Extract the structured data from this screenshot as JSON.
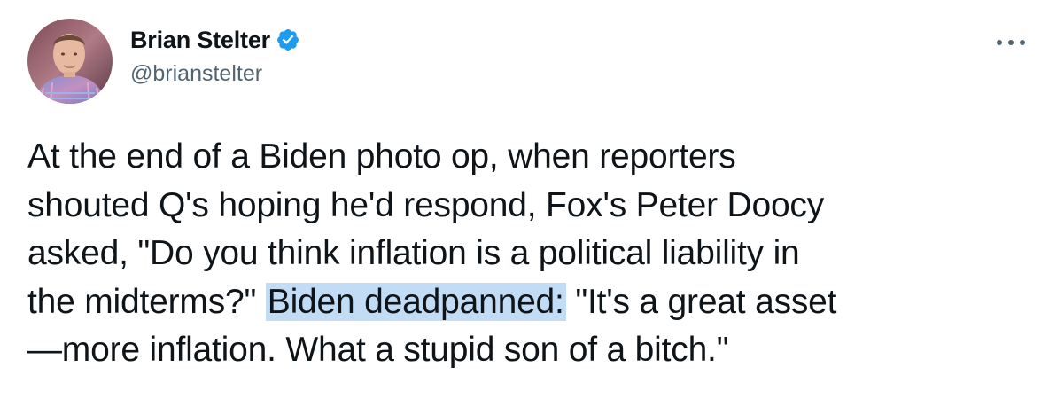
{
  "author": {
    "display_name": "Brian Stelter",
    "handle": "@brianstelter",
    "verified": true,
    "verified_icon": "verified-badge-icon",
    "verified_color": "#1d9bf0"
  },
  "menu": {
    "icon": "more-horizontal-icon"
  },
  "tweet": {
    "line1": "At the end of a Biden photo op, when reporters",
    "line2": "shouted Q's hoping he'd respond, Fox's Peter Doocy",
    "line3": "asked, \"Do you think inflation is a political liability in",
    "line4_before": "the midterms?\" ",
    "line4_highlight": "Biden deadpanned:",
    "line4_after": " \"It's a great asset",
    "line5": "—more inflation. What a stupid son of a bitch.\"",
    "highlight_color": "#c3dcf6"
  },
  "colors": {
    "text": "#0f1419",
    "secondary": "#536471",
    "background": "#ffffff"
  }
}
